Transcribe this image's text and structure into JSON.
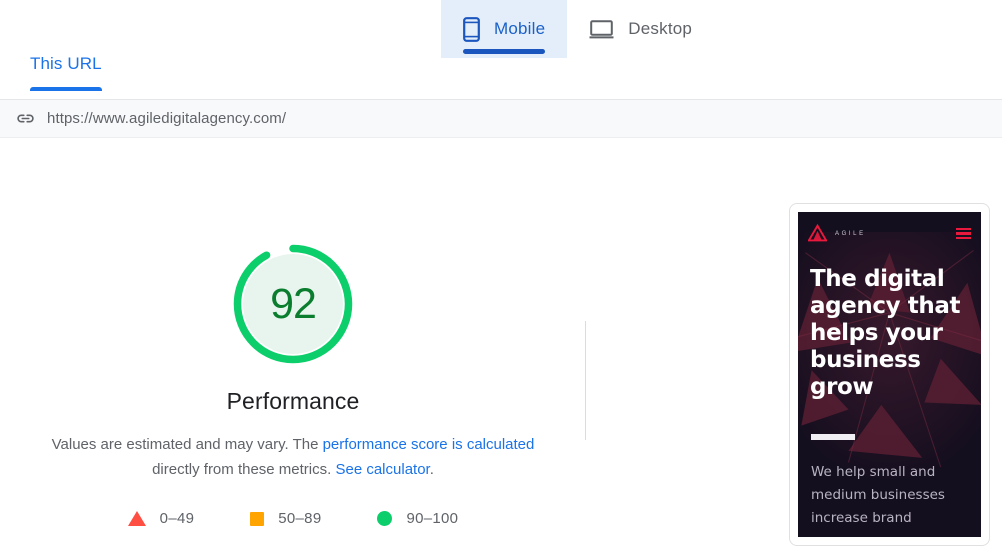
{
  "device_tabs": [
    {
      "label": "Mobile",
      "icon": "mobile-phone-icon",
      "active": true
    },
    {
      "label": "Desktop",
      "icon": "desktop-monitor-icon",
      "active": false
    }
  ],
  "url_tabs": [
    {
      "label": "This URL",
      "active": true
    }
  ],
  "url_bar": {
    "icon": "link-chain-icon",
    "url": "https://www.agiledigitalagency.com/"
  },
  "score": {
    "value": "92",
    "value_number": 92,
    "title": "Performance",
    "ring_color": "#0cce6b",
    "track_color": "#e8f5ee",
    "text_color": "#0a7d2e"
  },
  "description": {
    "line1_pre": "Values are estimated and may vary. The ",
    "line1_link": "performance score is calculated",
    "line2_pre": "directly from these metrics. ",
    "line2_link": "See calculator",
    "line2_post": "."
  },
  "legend": [
    {
      "shape": "triangle",
      "label": "0–49",
      "color": "#ff4e42"
    },
    {
      "shape": "square",
      "label": "50–89",
      "color": "#ffa400"
    },
    {
      "shape": "circle",
      "label": "90–100",
      "color": "#0cce6b"
    }
  ],
  "thumbnail": {
    "brand_word": "AGILE",
    "menu_icon": "hamburger-menu-icon",
    "heading": "The digital agency that helps your business grow",
    "body": "We help small and medium businesses increase brand"
  },
  "chart_data": {
    "type": "pie",
    "title": "Performance",
    "categories": [
      "Score",
      "Remainder"
    ],
    "values": [
      92,
      8
    ],
    "ylim": [
      0,
      100
    ],
    "legend": [
      "0–49",
      "50–89",
      "90–100"
    ],
    "annotations": [
      "92"
    ]
  }
}
